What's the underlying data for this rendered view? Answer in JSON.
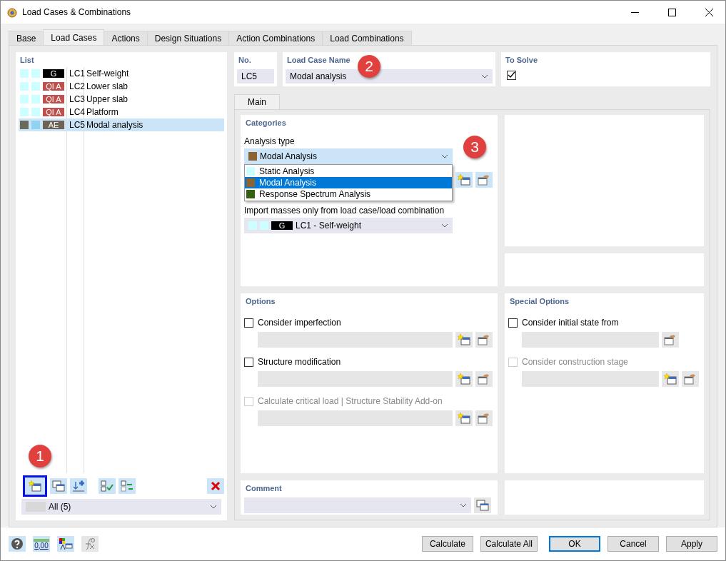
{
  "window": {
    "title": "Load Cases & Combinations"
  },
  "tabs": [
    {
      "label": "Base",
      "selected": false
    },
    {
      "label": "Load Cases",
      "selected": true
    },
    {
      "label": "Actions",
      "selected": false
    },
    {
      "label": "Design Situations",
      "selected": false
    },
    {
      "label": "Action Combinations",
      "selected": false
    },
    {
      "label": "Load Combinations",
      "selected": false
    }
  ],
  "list": {
    "heading": "List",
    "items": [
      {
        "swatches": [
          {
            "color": "#ccffff"
          },
          {
            "color": "#ccffff"
          }
        ],
        "badge": {
          "text": "G",
          "color": "#000000"
        },
        "number": "LC1",
        "name": "Self-weight",
        "selected": false
      },
      {
        "swatches": [
          {
            "color": "#ccffff"
          },
          {
            "color": "#ccffff"
          }
        ],
        "badge": {
          "text": "QI A",
          "color": "#c0504d"
        },
        "number": "LC2",
        "name": "Lower slab",
        "selected": false
      },
      {
        "swatches": [
          {
            "color": "#ccffff"
          },
          {
            "color": "#ccffff"
          }
        ],
        "badge": {
          "text": "QI A",
          "color": "#c0504d"
        },
        "number": "LC3",
        "name": "Upper slab",
        "selected": false
      },
      {
        "swatches": [
          {
            "color": "#ccffff"
          },
          {
            "color": "#ccffff"
          }
        ],
        "badge": {
          "text": "QI A",
          "color": "#c0504d"
        },
        "number": "LC4",
        "name": "Platform",
        "selected": false
      },
      {
        "swatches": [
          {
            "color": "#6b6a5a"
          },
          {
            "color": "#8fd3f0"
          }
        ],
        "badge": {
          "text": "AE",
          "color": "#6e6456"
        },
        "number": "LC5",
        "name": "Modal analysis",
        "selected": true
      }
    ],
    "toolbar": [
      {
        "kind": "new",
        "highlighted": true
      },
      {
        "kind": "copy",
        "highlighted": false
      },
      {
        "kind": "insert",
        "highlighted": false
      },
      {
        "kind": "check",
        "highlighted": false
      },
      {
        "kind": "toggle",
        "highlighted": false
      },
      {
        "kind": "delete",
        "highlighted": false
      }
    ],
    "filter": {
      "value": "All (5)"
    }
  },
  "number": {
    "label": "No.",
    "value": "LC5"
  },
  "load_case_name": {
    "label": "Load Case Name",
    "value": "Modal analysis"
  },
  "to_solve": {
    "label": "To Solve",
    "checked": true
  },
  "inner_tabs": [
    {
      "label": "Main",
      "selected": true
    }
  ],
  "categories": {
    "heading": "Categories",
    "analysis_type": {
      "label": "Analysis type",
      "value": "Modal Analysis",
      "color": "#8b6432",
      "expanded": true,
      "options": [
        {
          "label": "Static Analysis",
          "color": "#ccffff",
          "selected": false
        },
        {
          "label": "Modal Analysis",
          "color": "#8b6432",
          "selected": true
        },
        {
          "label": "Response Spectrum Analysis",
          "color": "#365f14",
          "selected": false
        }
      ]
    },
    "import_masses": {
      "label": "Import masses only from load case/load combination",
      "swatches": [
        {
          "color": "#ccffff"
        },
        {
          "color": "#ccffff"
        }
      ],
      "badge": {
        "text": "G",
        "color": "#000000"
      },
      "value": "LC1 - Self-weight"
    }
  },
  "options": {
    "heading": "Options",
    "items": [
      {
        "label": "Consider imperfection",
        "checked": false,
        "disabled": false
      },
      {
        "label": "Structure modification",
        "checked": false,
        "disabled": false
      },
      {
        "label": "Calculate critical load | Structure Stability Add-on",
        "checked": false,
        "disabled": true
      }
    ]
  },
  "special_options": {
    "heading": "Special Options",
    "items": [
      {
        "label": "Consider initial state from",
        "checked": false,
        "disabled": false,
        "kind": "single"
      },
      {
        "label": "Consider construction stage",
        "checked": false,
        "disabled": true,
        "kind": "double"
      }
    ]
  },
  "comment": {
    "heading": "Comment"
  },
  "tools": [
    {
      "kind": "help"
    },
    {
      "kind": "units",
      "text": "0,00"
    },
    {
      "kind": "display"
    },
    {
      "kind": "formula"
    }
  ],
  "buttons": [
    {
      "label": "Calculate",
      "default": false
    },
    {
      "label": "Calculate All",
      "default": false
    },
    {
      "label": "OK",
      "default": true
    },
    {
      "label": "Cancel",
      "default": false
    },
    {
      "label": "Apply",
      "default": false
    }
  ],
  "callouts": [
    "1",
    "2",
    "3"
  ]
}
